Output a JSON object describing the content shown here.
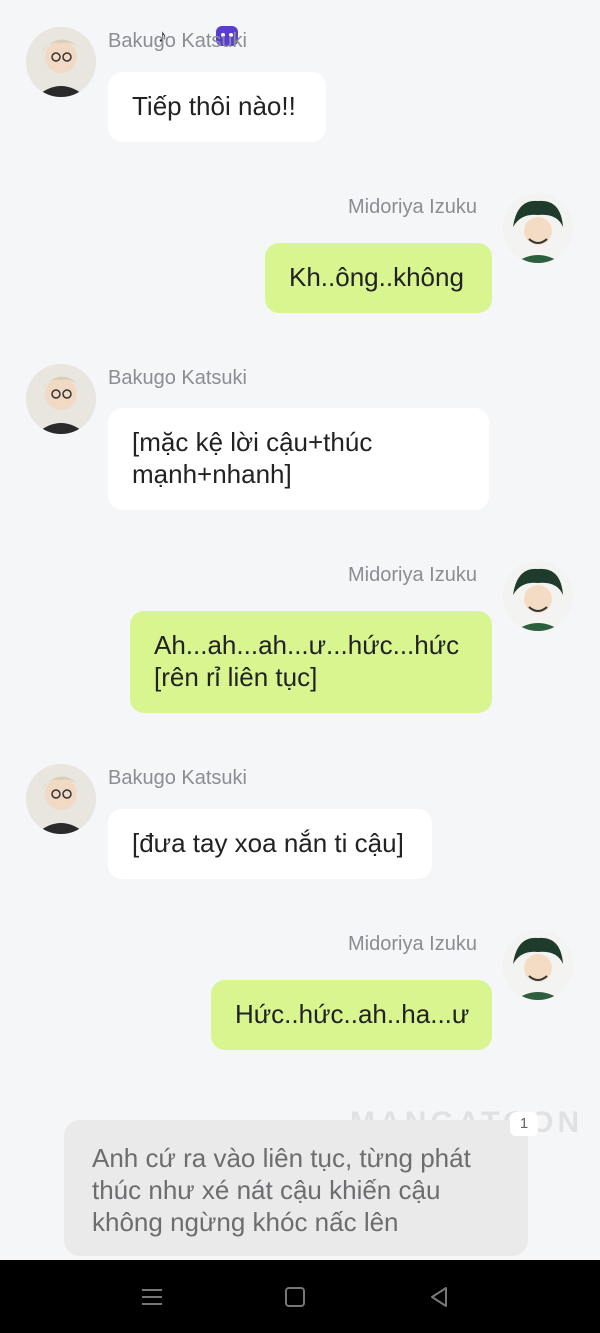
{
  "status_bar_overlay": {
    "tiktok_icon": "♪"
  },
  "messages": [
    {
      "sender": "Bakugo Katsuki",
      "side": "left",
      "text": "Tiếp thôi nào!!",
      "avatar": "bakugo-avatar"
    },
    {
      "sender": "Midoriya Izuku",
      "side": "right",
      "text": "Kh..ông..không",
      "avatar": "midoriya-avatar"
    },
    {
      "sender": "Bakugo Katsuki",
      "side": "left",
      "text": "[mặc kệ lời cậu+thúc mạnh+nhanh]",
      "avatar": "bakugo-avatar"
    },
    {
      "sender": "Midoriya Izuku",
      "side": "right",
      "text": "Ah...ah...ah...ư...hức...hức [rên rỉ liên tục]",
      "avatar": "midoriya-avatar"
    },
    {
      "sender": "Bakugo Katsuki",
      "side": "left",
      "text": "[đưa tay xoa nắn ti cậu]",
      "avatar": "bakugo-avatar"
    },
    {
      "sender": "Midoriya Izuku",
      "side": "right",
      "text": "Hức..hức..ah..ha...ư",
      "avatar": "midoriya-avatar"
    }
  ],
  "narration": {
    "text": "Anh cứ ra vào liên tục, từng phát thúc như xé nát cậu khiến cậu không ngừng khóc nấc lên",
    "badge": "1"
  },
  "watermark": "MANGATOON",
  "colors": {
    "left_bubble": "#ffffff",
    "right_bubble": "#d8f58f",
    "background": "#f5f6f8"
  },
  "nav": {
    "icons": [
      "menu-icon",
      "home-square-icon",
      "back-triangle-icon"
    ]
  }
}
